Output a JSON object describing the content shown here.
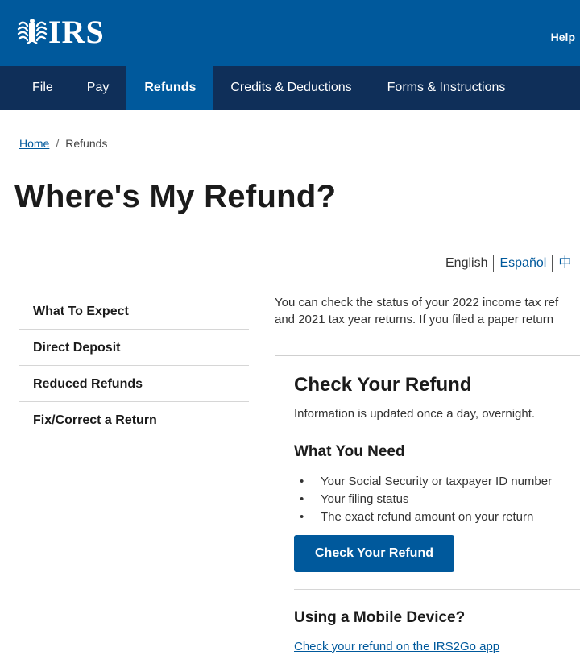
{
  "header": {
    "logo_text": "IRS",
    "help_label": "Help"
  },
  "nav": {
    "items": [
      {
        "label": "File"
      },
      {
        "label": "Pay"
      },
      {
        "label": "Refunds",
        "active": true
      },
      {
        "label": "Credits & Deductions"
      },
      {
        "label": "Forms & Instructions"
      }
    ]
  },
  "breadcrumb": {
    "home": "Home",
    "separator": "/",
    "current": "Refunds"
  },
  "page_title": "Where's My Refund?",
  "languages": {
    "english": "English",
    "spanish": "Español",
    "chinese": "中"
  },
  "sidebar": {
    "items": [
      {
        "label": "What To Expect"
      },
      {
        "label": "Direct Deposit"
      },
      {
        "label": "Reduced Refunds"
      },
      {
        "label": "Fix/Correct a Return"
      }
    ]
  },
  "intro": {
    "line1": "You can check the status of your 2022 income tax ref",
    "line2": "and 2021 tax year returns.  If you filed a paper return"
  },
  "card": {
    "title": "Check Your Refund",
    "subtitle": "Information is updated once a day, overnight.",
    "need_heading": "What You Need",
    "need_items": [
      "Your Social Security or taxpayer ID number",
      "Your filing status",
      "The exact refund amount on your return"
    ],
    "button_label": "Check Your Refund",
    "mobile_heading": "Using a Mobile Device?",
    "mobile_link": "Check your refund on the IRS2Go app"
  },
  "colors": {
    "header_blue": "#00599c",
    "nav_navy": "#0f2f59",
    "link_blue": "#00599c"
  }
}
